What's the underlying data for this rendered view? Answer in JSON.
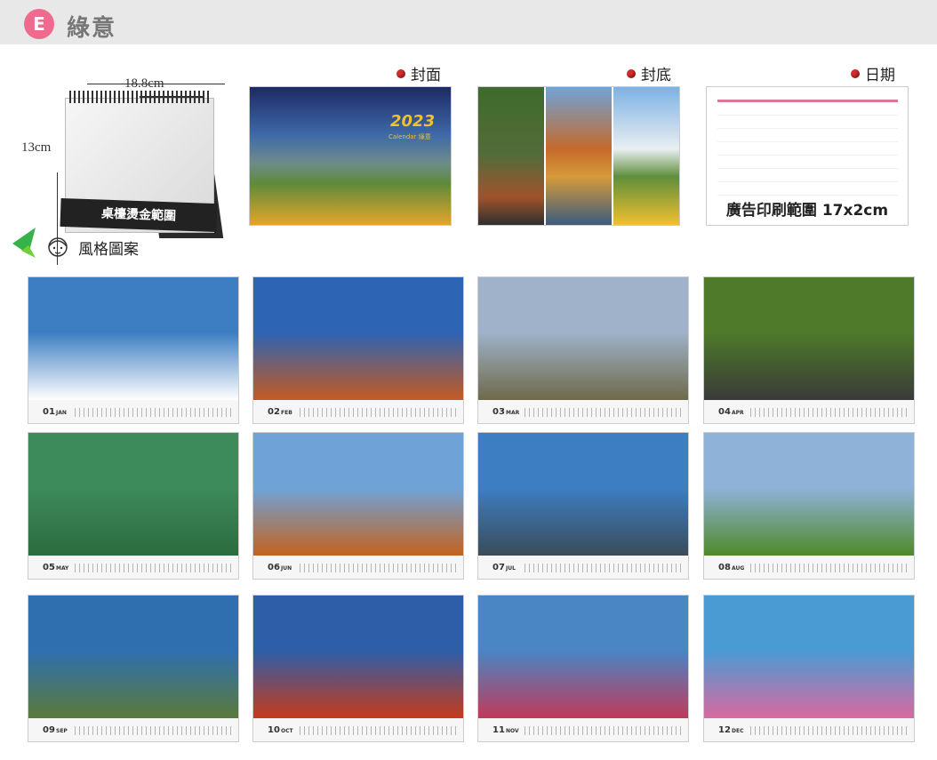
{
  "header": {
    "badge": "E",
    "title": "綠意"
  },
  "desk_calendar": {
    "width_label": "18.8cm",
    "height_label": "13cm",
    "band_text": "桌檯燙金範圍"
  },
  "previews": {
    "cover_label": "封面",
    "back_label": "封底",
    "date_label": "日期",
    "cover_year": "2023",
    "cover_subtitle": "Calendar  綠意",
    "date_caption": "廣告印刷範圍 17x2cm"
  },
  "section": {
    "style_label": "風格圖案"
  },
  "colors": {
    "badge": "#ef6a8c",
    "topbar": "#e8e8e8",
    "dot": "#d32a2a"
  },
  "months": [
    {
      "num": "01",
      "name": "JAN",
      "c1": "#3d7ec2",
      "c2": "#ffffff"
    },
    {
      "num": "02",
      "name": "FEB",
      "c1": "#2d64b4",
      "c2": "#c55a22"
    },
    {
      "num": "03",
      "name": "MAR",
      "c1": "#9fb2c9",
      "c2": "#6e6a4a"
    },
    {
      "num": "04",
      "name": "APR",
      "c1": "#4e7a2a",
      "c2": "#3a3a3a"
    },
    {
      "num": "05",
      "name": "MAY",
      "c1": "#3d8a5a",
      "c2": "#2c6b3e"
    },
    {
      "num": "06",
      "name": "JUN",
      "c1": "#6fa3d8",
      "c2": "#c4621d"
    },
    {
      "num": "07",
      "name": "JUL",
      "c1": "#3d7ec2",
      "c2": "#3a4c5a"
    },
    {
      "num": "08",
      "name": "AUG",
      "c1": "#8fb2d8",
      "c2": "#4f8a2a"
    },
    {
      "num": "09",
      "name": "SEP",
      "c1": "#2f6fb0",
      "c2": "#5a7a3a"
    },
    {
      "num": "10",
      "name": "OCT",
      "c1": "#2e5ea8",
      "c2": "#c63a1c"
    },
    {
      "num": "11",
      "name": "NOV",
      "c1": "#4a85c4",
      "c2": "#c03a5a"
    },
    {
      "num": "12",
      "name": "DEC",
      "c1": "#4a9ad4",
      "c2": "#d86aa0"
    }
  ]
}
